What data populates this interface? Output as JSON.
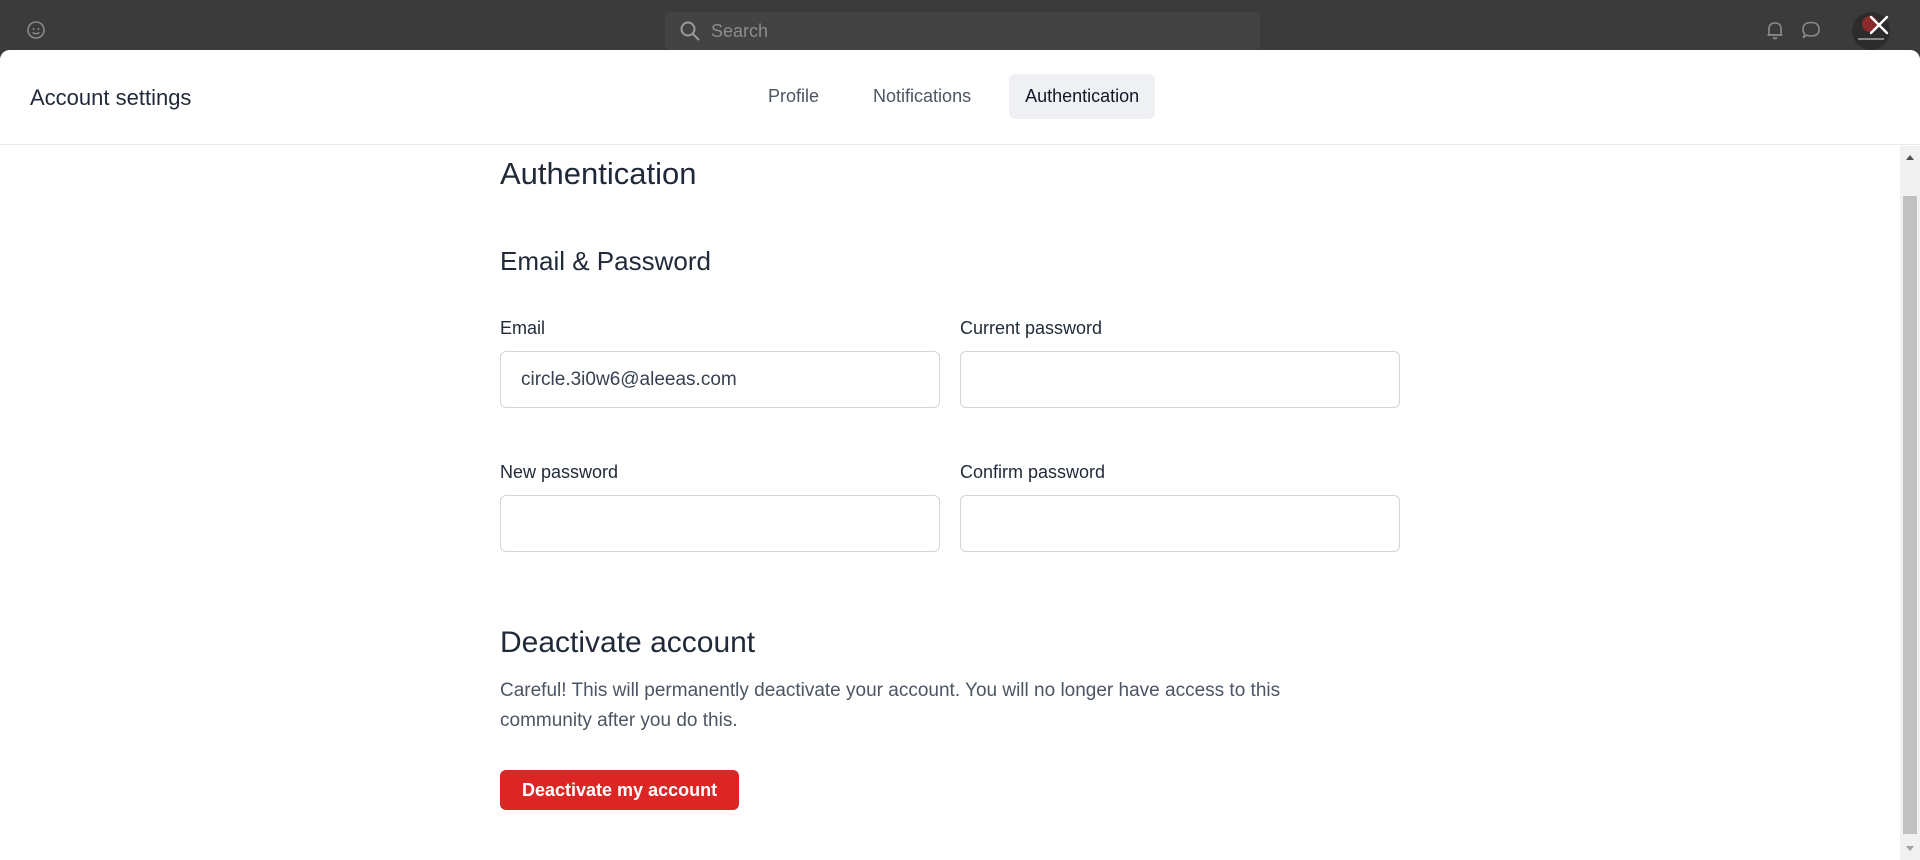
{
  "topbar": {
    "search_placeholder": "Search",
    "icons": [
      "logo-icon",
      "search-icon",
      "bell-icon",
      "chat-icon",
      "avatar"
    ]
  },
  "modal": {
    "title": "Account settings",
    "tabs": [
      {
        "label": "Profile",
        "active": false
      },
      {
        "label": "Notifications",
        "active": false
      },
      {
        "label": "Authentication",
        "active": true
      }
    ],
    "close_icon": "close-icon"
  },
  "auth": {
    "heading": "Authentication",
    "email_password_heading": "Email & Password",
    "email": {
      "label": "Email",
      "value": "circle.3i0w6@aleeas.com"
    },
    "current_password": {
      "label": "Current password",
      "value": ""
    },
    "new_password": {
      "label": "New password",
      "value": ""
    },
    "confirm_password": {
      "label": "Confirm password",
      "value": ""
    }
  },
  "deactivate": {
    "heading": "Deactivate account",
    "description": "Careful! This will permanently deactivate your account. You will no longer have access to this community after you do this.",
    "button_label": "Deactivate my account"
  },
  "colors": {
    "danger": "#dc2626",
    "active_tab_bg": "#eef0f3",
    "topbar_bg": "#3b3b3b"
  }
}
